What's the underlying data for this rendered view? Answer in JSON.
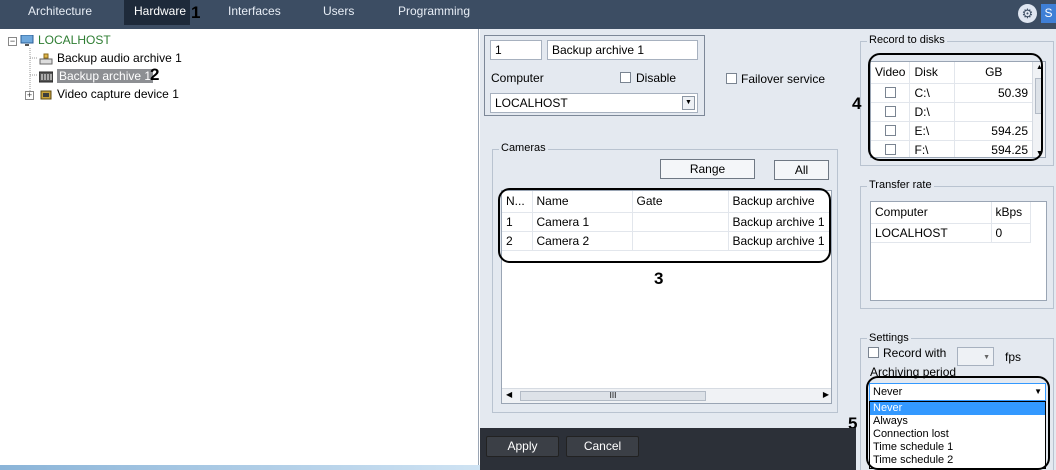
{
  "tabs": [
    {
      "label": "Architecture"
    },
    {
      "label": "Hardware"
    },
    {
      "label": "Interfaces"
    },
    {
      "label": "Users"
    },
    {
      "label": "Programming"
    }
  ],
  "markers": {
    "m1": "1",
    "m2": "2",
    "m3": "3",
    "m4": "4",
    "m5": "5"
  },
  "top_right": {
    "s_label": "S"
  },
  "tree": {
    "root": "LOCALHOST",
    "items": [
      {
        "label": "Backup audio archive 1"
      },
      {
        "label": "Backup archive 1"
      },
      {
        "label": "Video capture device 1"
      }
    ]
  },
  "object": {
    "id_value": "1",
    "name_value": "Backup archive 1",
    "computer_label": "Computer",
    "disable_label": "Disable",
    "computer_value": "LOCALHOST",
    "failover_label": "Failover service"
  },
  "cameras": {
    "title": "Cameras",
    "range_label": "Range",
    "all_label": "All",
    "columns": [
      "N...",
      "Name",
      "Gate",
      "Backup archive"
    ],
    "rows": [
      [
        "1",
        "Camera 1",
        "",
        "Backup archive 1"
      ],
      [
        "2",
        "Camera 2",
        "",
        "Backup archive 1"
      ]
    ],
    "scroll_thumb": "III"
  },
  "record": {
    "title": "Record to disks",
    "columns": [
      "Video",
      "Disk",
      "GB"
    ],
    "rows": [
      {
        "disk": "C:\\",
        "gb": "50.39"
      },
      {
        "disk": "D:\\",
        "gb": ""
      },
      {
        "disk": "E:\\",
        "gb": "594.25"
      },
      {
        "disk": "F:\\",
        "gb": "594.25"
      }
    ]
  },
  "transfer": {
    "title": "Transfer rate",
    "columns": [
      "Computer",
      "kBps"
    ],
    "rows": [
      [
        "LOCALHOST",
        "0"
      ]
    ]
  },
  "settings": {
    "title": "Settings",
    "record_with_label": "Record with",
    "fps_label": "fps",
    "period_label": "Archiving period",
    "period_value": "Never",
    "options": [
      "Never",
      "Always",
      "Connection lost",
      "Time schedule 1",
      "Time schedule 2"
    ]
  },
  "footer": {
    "apply_label": "Apply",
    "cancel_label": "Cancel"
  },
  "colors": {
    "topbar": "#3c4d63",
    "panel": "#e4e9f0",
    "selection": "#3399ff",
    "tree_root": "#2e7d32"
  }
}
